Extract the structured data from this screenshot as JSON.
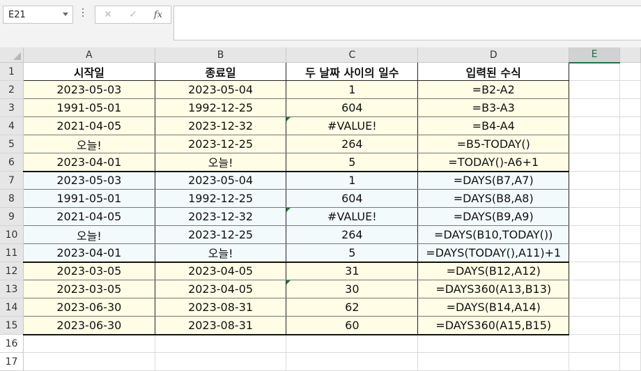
{
  "name_box": {
    "value": "E21"
  },
  "formula_bar": {
    "cancel_glyph": "✕",
    "enter_glyph": "✓",
    "fx_label": "fx",
    "value": ""
  },
  "columns": [
    "A",
    "B",
    "C",
    "D",
    "E"
  ],
  "selected_column": "E",
  "header_row": {
    "row": "1",
    "cells": [
      "시작일",
      "종료일",
      "두 날짜 사이의 일수",
      "입력된 수식"
    ]
  },
  "rows": [
    {
      "row": "2",
      "cells": [
        "2023-05-03",
        "2023-05-04",
        "1",
        "=B2-A2"
      ]
    },
    {
      "row": "3",
      "cells": [
        "1991-05-01",
        "1992-12-25",
        "604",
        "=B3-A3"
      ]
    },
    {
      "row": "4",
      "cells": [
        "2021-04-05",
        "2023-12-32",
        "#VALUE!",
        "=B4-A4"
      ]
    },
    {
      "row": "5",
      "cells": [
        "오늘!",
        "2023-12-25",
        "264",
        "=B5-TODAY()"
      ]
    },
    {
      "row": "6",
      "cells": [
        "2023-04-01",
        "오늘!",
        "5",
        "=TODAY()-A6+1"
      ]
    },
    {
      "row": "7",
      "cells": [
        "2023-05-03",
        "2023-05-04",
        "1",
        "=DAYS(B7,A7)"
      ]
    },
    {
      "row": "8",
      "cells": [
        "1991-05-01",
        "1992-12-25",
        "604",
        "=DAYS(B8,A8)"
      ]
    },
    {
      "row": "9",
      "cells": [
        "2021-04-05",
        "2023-12-32",
        "#VALUE!",
        "=DAYS(B9,A9)"
      ]
    },
    {
      "row": "10",
      "cells": [
        "오늘!",
        "2023-12-25",
        "264",
        "=DAYS(B10,TODAY())"
      ]
    },
    {
      "row": "11",
      "cells": [
        "2023-04-01",
        "오늘!",
        "5",
        "=DAYS(TODAY(),A11)+1"
      ]
    },
    {
      "row": "12",
      "cells": [
        "2023-03-05",
        "2023-04-05",
        "31",
        "=DAYS(B12,A12)"
      ]
    },
    {
      "row": "13",
      "cells": [
        "2023-03-05",
        "2023-04-05",
        "30",
        "=DAYS360(A13,B13)"
      ]
    },
    {
      "row": "14",
      "cells": [
        "2023-06-30",
        "2023-08-31",
        "62",
        "=DAYS(B14,A14)"
      ]
    },
    {
      "row": "15",
      "cells": [
        "2023-06-30",
        "2023-08-31",
        "60",
        "=DAYS360(A15,B15)"
      ]
    }
  ],
  "blank_rows": [
    "16",
    "17"
  ],
  "colors": {
    "cell_fill_yellow": "#fffde6",
    "cell_fill_blue": "#f3fafc",
    "selected_header_accent": "#217346",
    "error_indicator": "#1e7b34"
  }
}
